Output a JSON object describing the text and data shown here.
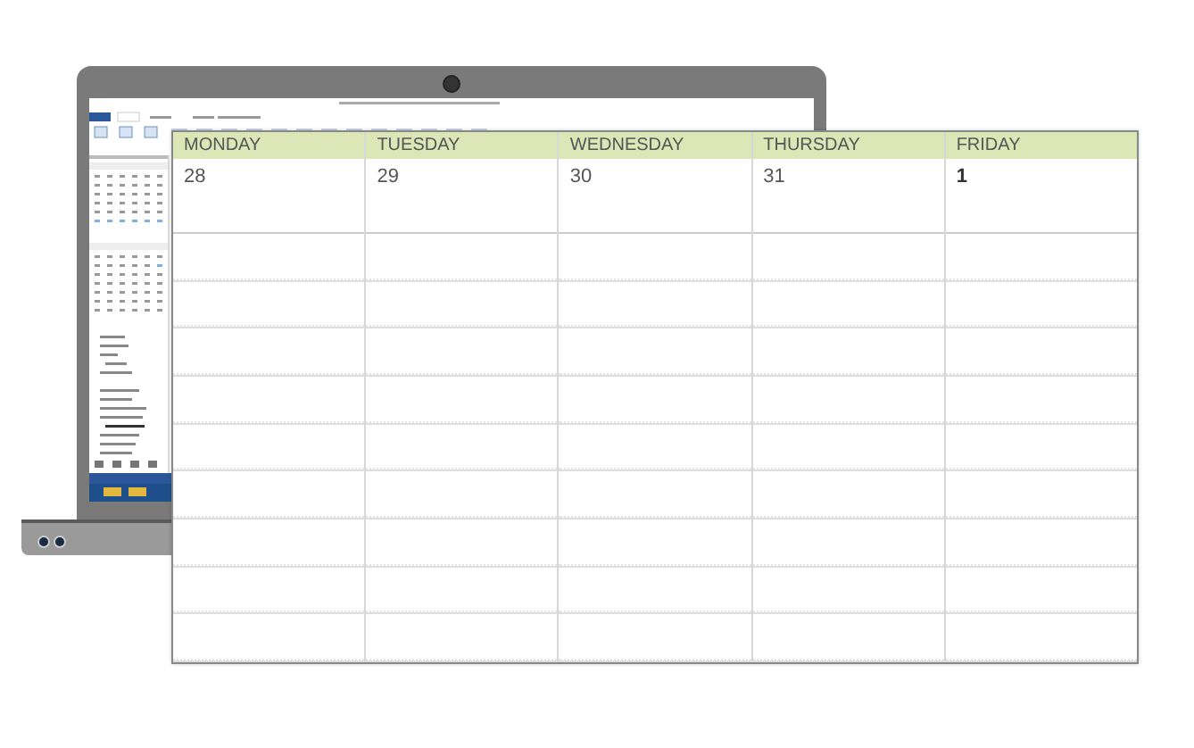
{
  "calendar": {
    "days": [
      {
        "name": "MONDAY",
        "date": "28",
        "month_start": false
      },
      {
        "name": "TUESDAY",
        "date": "29",
        "month_start": false
      },
      {
        "name": "WEDNESDAY",
        "date": "30",
        "month_start": false
      },
      {
        "name": "THURSDAY",
        "date": "31",
        "month_start": false
      },
      {
        "name": "FRIDAY",
        "date": "1",
        "month_start": true
      }
    ]
  }
}
